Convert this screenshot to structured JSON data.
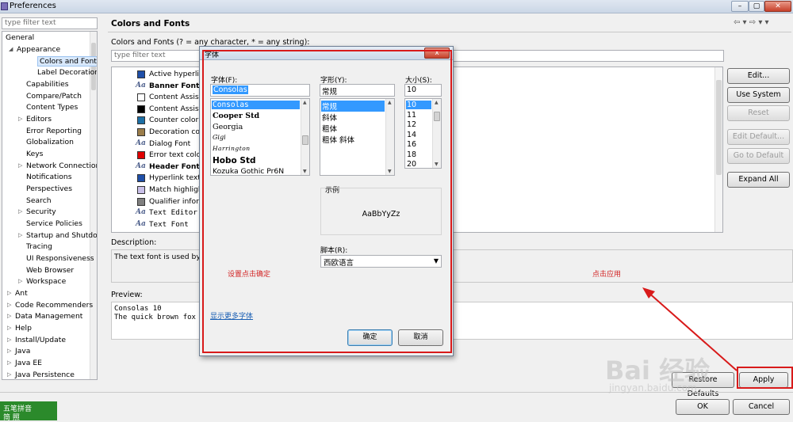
{
  "window": {
    "title": "Preferences"
  },
  "sidebar": {
    "filter_placeholder": "type filter text",
    "items": [
      {
        "label": "General"
      },
      {
        "label": "Appearance"
      },
      {
        "label": "Colors and Fonts"
      },
      {
        "label": "Label Decorations"
      },
      {
        "label": "Capabilities"
      },
      {
        "label": "Compare/Patch"
      },
      {
        "label": "Content Types"
      },
      {
        "label": "Editors"
      },
      {
        "label": "Error Reporting"
      },
      {
        "label": "Globalization"
      },
      {
        "label": "Keys"
      },
      {
        "label": "Network Connections"
      },
      {
        "label": "Notifications"
      },
      {
        "label": "Perspectives"
      },
      {
        "label": "Search"
      },
      {
        "label": "Security"
      },
      {
        "label": "Service Policies"
      },
      {
        "label": "Startup and Shutdown"
      },
      {
        "label": "Tracing"
      },
      {
        "label": "UI Responsiveness"
      },
      {
        "label": "Web Browser"
      },
      {
        "label": "Workspace"
      },
      {
        "label": "Ant"
      },
      {
        "label": "Code Recommenders"
      },
      {
        "label": "Data Management"
      },
      {
        "label": "Help"
      },
      {
        "label": "Install/Update"
      },
      {
        "label": "Java"
      },
      {
        "label": "Java EE"
      },
      {
        "label": "Java Persistence"
      }
    ]
  },
  "main": {
    "title": "Colors and Fonts",
    "subtitle": "Colors and Fonts (? = any character, * = any string):",
    "filter_placeholder": "type filter text",
    "list": [
      {
        "label": "Active hyperlink",
        "kind": "color",
        "color": "#1f4fa8"
      },
      {
        "label": "Banner Font",
        "kind": "font",
        "bold": true
      },
      {
        "label": "Content Assist",
        "kind": "color",
        "color": "#ffffff"
      },
      {
        "label": "Content Assist",
        "kind": "color",
        "color": "#000000"
      },
      {
        "label": "Counter color",
        "kind": "color",
        "color": "#1d6fa5"
      },
      {
        "label": "Decoration color",
        "kind": "color",
        "color": "#9b7d4a"
      },
      {
        "label": "Dialog Font",
        "kind": "font",
        "bold": false
      },
      {
        "label": "Error text color",
        "kind": "color",
        "color": "#e00000"
      },
      {
        "label": "Header Font",
        "kind": "font",
        "bold": true
      },
      {
        "label": "Hyperlink text",
        "kind": "color",
        "color": "#1f4fa8"
      },
      {
        "label": "Match highlight",
        "kind": "color",
        "color": "#c9c0e8"
      },
      {
        "label": "Qualifier information",
        "kind": "color",
        "color": "#808080"
      },
      {
        "label": "Text Editor",
        "kind": "font",
        "bold": false,
        "mono": true
      },
      {
        "label": "Text Font",
        "kind": "font",
        "bold": false,
        "mono": true
      }
    ],
    "buttons": {
      "edit": "Edit...",
      "system_font": "Use System Font",
      "reset": "Reset",
      "edit_default": "Edit Default...",
      "go_default": "Go to Default",
      "expand_all": "Expand All"
    },
    "description_label": "Description:",
    "description_text": "The text font is used by t",
    "preview_label": "Preview:",
    "preview_lines": [
      "Consolas 10",
      "The quick brown fox j"
    ],
    "restore_label": "Restore Defaults",
    "apply_label": "Apply",
    "ok_label": "OK",
    "cancel_label": "Cancel"
  },
  "font_dialog": {
    "title": "字体",
    "close": "x",
    "font_label": "字体(F):",
    "font_value": "Consolas",
    "fonts": [
      "Consolas",
      "Cooper Std",
      "Georgia",
      "Gigi",
      "Harrington",
      "Hobo Std",
      "Kozuka Gothic Pr6N"
    ],
    "style_label": "字形(Y):",
    "style_value": "常规",
    "styles": [
      "常规",
      "斜体",
      "粗体",
      "粗体 斜体"
    ],
    "size_label": "大小(S):",
    "size_value": "10",
    "sizes": [
      "10",
      "11",
      "12",
      "14",
      "16",
      "18",
      "20"
    ],
    "sample_label": "示例",
    "sample_text": "AaBbYyZz",
    "script_label": "脚本(R):",
    "script_value": "西欧语言",
    "more_fonts": "显示更多字体",
    "ok": "确定",
    "cancel": "取消"
  },
  "annotations": {
    "confirm_note": "设置点击确定",
    "apply_note": "点击应用",
    "color": "#d81a1a"
  },
  "ime": {
    "name": "五笔拼音",
    "mode": "简 照"
  },
  "watermark": {
    "brand": "Bai 经验",
    "url": "jingyan.baidu.com"
  }
}
